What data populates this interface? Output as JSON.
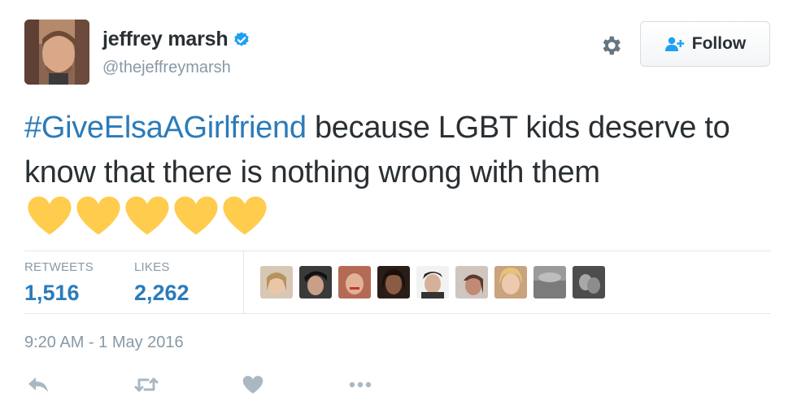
{
  "user": {
    "display_name": "jeffrey marsh",
    "handle": "@thejeffreymarsh",
    "verified": true
  },
  "follow_button": {
    "label": "Follow"
  },
  "tweet": {
    "hashtag": "#GiveElsaAGirlfriend",
    "text": " because LGBT kids deserve to know that there is nothing wrong with them",
    "emoji": [
      "yellow-heart",
      "yellow-heart",
      "yellow-heart",
      "yellow-heart",
      "yellow-heart"
    ]
  },
  "stats": {
    "retweets_label": "RETWEETS",
    "retweets_value": "1,516",
    "likes_label": "LIKES",
    "likes_value": "2,262"
  },
  "timestamp": "9:20 AM - 1 May 2016",
  "colors": {
    "link": "#2b7bb9",
    "text": "#292f33",
    "muted": "#8899a6",
    "verified": "#1da1f2",
    "heart_emoji": "#ffcc4d",
    "divider": "#e1e8ed"
  },
  "icons": [
    "gear-icon",
    "follow-person-icon",
    "verified-badge-icon",
    "reply-icon",
    "retweet-icon",
    "like-icon",
    "more-icon"
  ]
}
